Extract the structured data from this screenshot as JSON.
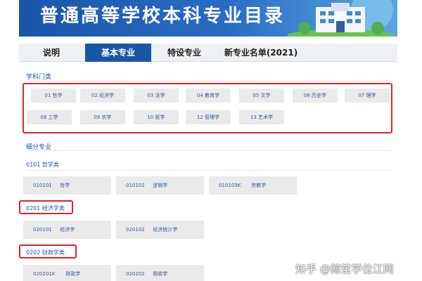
{
  "banner": {
    "title": "普通高等学校本科专业目录"
  },
  "tabs": [
    {
      "label": "说明",
      "active": false
    },
    {
      "label": "基本专业",
      "active": true
    },
    {
      "label": "特设专业",
      "active": false
    },
    {
      "label": "新专业名单(2021)",
      "active": false
    }
  ],
  "disciplines": {
    "heading": "学科门类",
    "items": [
      {
        "label": "01 哲学"
      },
      {
        "label": "02 经济学"
      },
      {
        "label": "03 法学"
      },
      {
        "label": "04 教育学"
      },
      {
        "label": "05 文学"
      },
      {
        "label": "06 历史学"
      },
      {
        "label": "07 理学"
      },
      {
        "label": "08 工学"
      },
      {
        "label": "09 农学"
      },
      {
        "label": "10 医学"
      },
      {
        "label": "12 管理学"
      },
      {
        "label": "13 艺术学"
      }
    ]
  },
  "majors": {
    "heading": "细分专业",
    "groups": [
      {
        "title": "0101 哲学类",
        "items": [
          {
            "code": "010101",
            "name": "哲学"
          },
          {
            "code": "010102",
            "name": "逻辑学"
          },
          {
            "code": "010103K",
            "name": "宗教学"
          }
        ]
      },
      {
        "title": "0201 经济学类",
        "items": [
          {
            "code": "020101",
            "name": "经济学"
          },
          {
            "code": "020102",
            "name": "经济统计学"
          }
        ]
      },
      {
        "title": "0202 财政学类",
        "items": [
          {
            "code": "020201K",
            "name": "财政学"
          },
          {
            "code": "020202",
            "name": "税收学"
          }
        ]
      }
    ]
  },
  "watermark": "知乎 @鲸笙学位江网",
  "colors": {
    "accent": "#1a56a5",
    "highlight": "#e0232b",
    "tile": "#eaeaea"
  }
}
